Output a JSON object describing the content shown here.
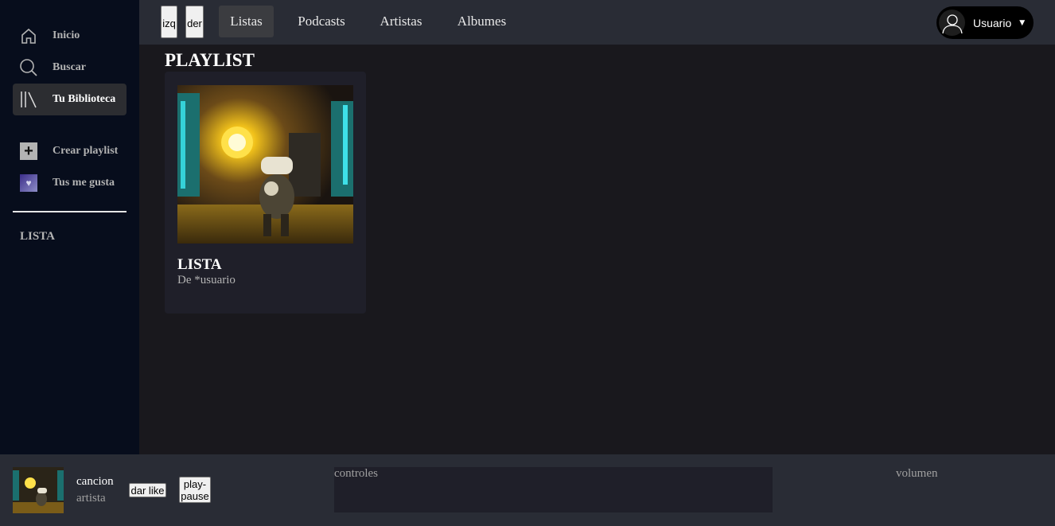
{
  "sidebar": {
    "items": [
      {
        "label": "Inicio",
        "icon": "home-icon"
      },
      {
        "label": "Buscar",
        "icon": "search-icon"
      },
      {
        "label": "Tu Biblioteca",
        "icon": "library-icon",
        "active": true
      },
      {
        "label": "Crear playlist",
        "icon": "plus-icon"
      },
      {
        "label": "Tus me gusta",
        "icon": "heart-icon"
      }
    ],
    "list_label": "LISTA"
  },
  "topbar": {
    "back_label": "izq",
    "forward_label": "der",
    "tabs": [
      {
        "label": "Listas",
        "active": true
      },
      {
        "label": "Podcasts"
      },
      {
        "label": "Artistas"
      },
      {
        "label": "Albumes"
      }
    ],
    "user_label": "Usuario",
    "user_caret": "▼"
  },
  "main": {
    "title": "PLAYLIST",
    "cards": [
      {
        "title": "LISTA",
        "subtitle": "De *usuario"
      }
    ]
  },
  "player": {
    "song": "cancion",
    "artist": "artista",
    "like_label": "dar like",
    "play_label": "play-pause",
    "controls_label": "controles",
    "volume_label": "volumen"
  },
  "colors": {
    "sidebar_bg": "#070d1c",
    "topbar_bg": "#292c35",
    "main_bg": "#19181d",
    "card_bg": "#1f1f29"
  }
}
